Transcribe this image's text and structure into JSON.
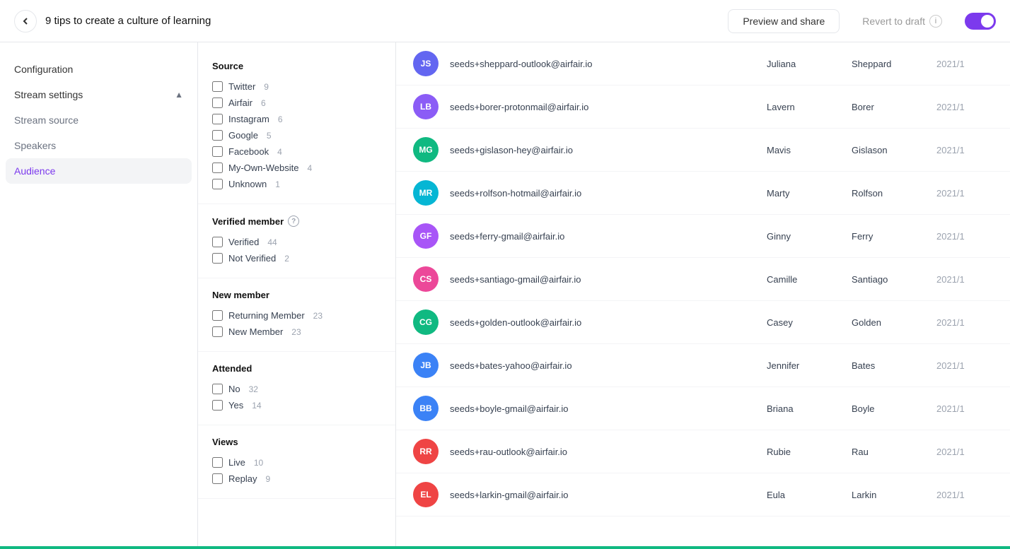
{
  "header": {
    "back_label": "←",
    "title": "9 tips to create a culture of learning",
    "preview_label": "Preview and share",
    "revert_label": "Revert to draft",
    "revert_info": "i"
  },
  "sidebar": {
    "config_label": "Configuration",
    "stream_settings_label": "Stream settings",
    "stream_source_label": "Stream source",
    "speakers_label": "Speakers",
    "audience_label": "Audience"
  },
  "filters": {
    "source_group": {
      "title": "Source",
      "items": [
        {
          "label": "Twitter",
          "count": "9"
        },
        {
          "label": "Airfair",
          "count": "6"
        },
        {
          "label": "Instagram",
          "count": "6"
        },
        {
          "label": "Google",
          "count": "5"
        },
        {
          "label": "Facebook",
          "count": "4"
        },
        {
          "label": "My-Own-Website",
          "count": "4"
        },
        {
          "label": "Unknown",
          "count": "1"
        }
      ]
    },
    "verified_group": {
      "title": "Verified member",
      "has_help": true,
      "items": [
        {
          "label": "Verified",
          "count": "44"
        },
        {
          "label": "Not Verified",
          "count": "2"
        }
      ]
    },
    "new_member_group": {
      "title": "New member",
      "items": [
        {
          "label": "Returning Member",
          "count": "23"
        },
        {
          "label": "New Member",
          "count": "23"
        }
      ]
    },
    "attended_group": {
      "title": "Attended",
      "items": [
        {
          "label": "No",
          "count": "32"
        },
        {
          "label": "Yes",
          "count": "14"
        }
      ]
    },
    "views_group": {
      "title": "Views",
      "items": [
        {
          "label": "Live",
          "count": "10"
        },
        {
          "label": "Replay",
          "count": "9"
        }
      ]
    }
  },
  "audience": {
    "rows": [
      {
        "initials": "JS",
        "color": "#6366f1",
        "email": "seeds+sheppard-outlook@airfair.io",
        "first": "Juliana",
        "last": "Sheppard",
        "date": "2021/1"
      },
      {
        "initials": "LB",
        "color": "#8b5cf6",
        "email": "seeds+borer-protonmail@airfair.io",
        "first": "Lavern",
        "last": "Borer",
        "date": "2021/1"
      },
      {
        "initials": "MG",
        "color": "#10b981",
        "email": "seeds+gislason-hey@airfair.io",
        "first": "Mavis",
        "last": "Gislason",
        "date": "2021/1"
      },
      {
        "initials": "MR",
        "color": "#06b6d4",
        "email": "seeds+rolfson-hotmail@airfair.io",
        "first": "Marty",
        "last": "Rolfson",
        "date": "2021/1"
      },
      {
        "initials": "GF",
        "color": "#a855f7",
        "email": "seeds+ferry-gmail@airfair.io",
        "first": "Ginny",
        "last": "Ferry",
        "date": "2021/1"
      },
      {
        "initials": "CS",
        "color": "#ec4899",
        "email": "seeds+santiago-gmail@airfair.io",
        "first": "Camille",
        "last": "Santiago",
        "date": "2021/1"
      },
      {
        "initials": "CG",
        "color": "#10b981",
        "email": "seeds+golden-outlook@airfair.io",
        "first": "Casey",
        "last": "Golden",
        "date": "2021/1"
      },
      {
        "initials": "JB",
        "color": "#3b82f6",
        "email": "seeds+bates-yahoo@airfair.io",
        "first": "Jennifer",
        "last": "Bates",
        "date": "2021/1"
      },
      {
        "initials": "BB",
        "color": "#3b82f6",
        "email": "seeds+boyle-gmail@airfair.io",
        "first": "Briana",
        "last": "Boyle",
        "date": "2021/1"
      },
      {
        "initials": "RR",
        "color": "#ef4444",
        "email": "seeds+rau-outlook@airfair.io",
        "first": "Rubie",
        "last": "Rau",
        "date": "2021/1"
      },
      {
        "initials": "EL",
        "color": "#ef4444",
        "email": "seeds+larkin-gmail@airfair.io",
        "first": "Eula",
        "last": "Larkin",
        "date": "2021/1"
      }
    ]
  }
}
